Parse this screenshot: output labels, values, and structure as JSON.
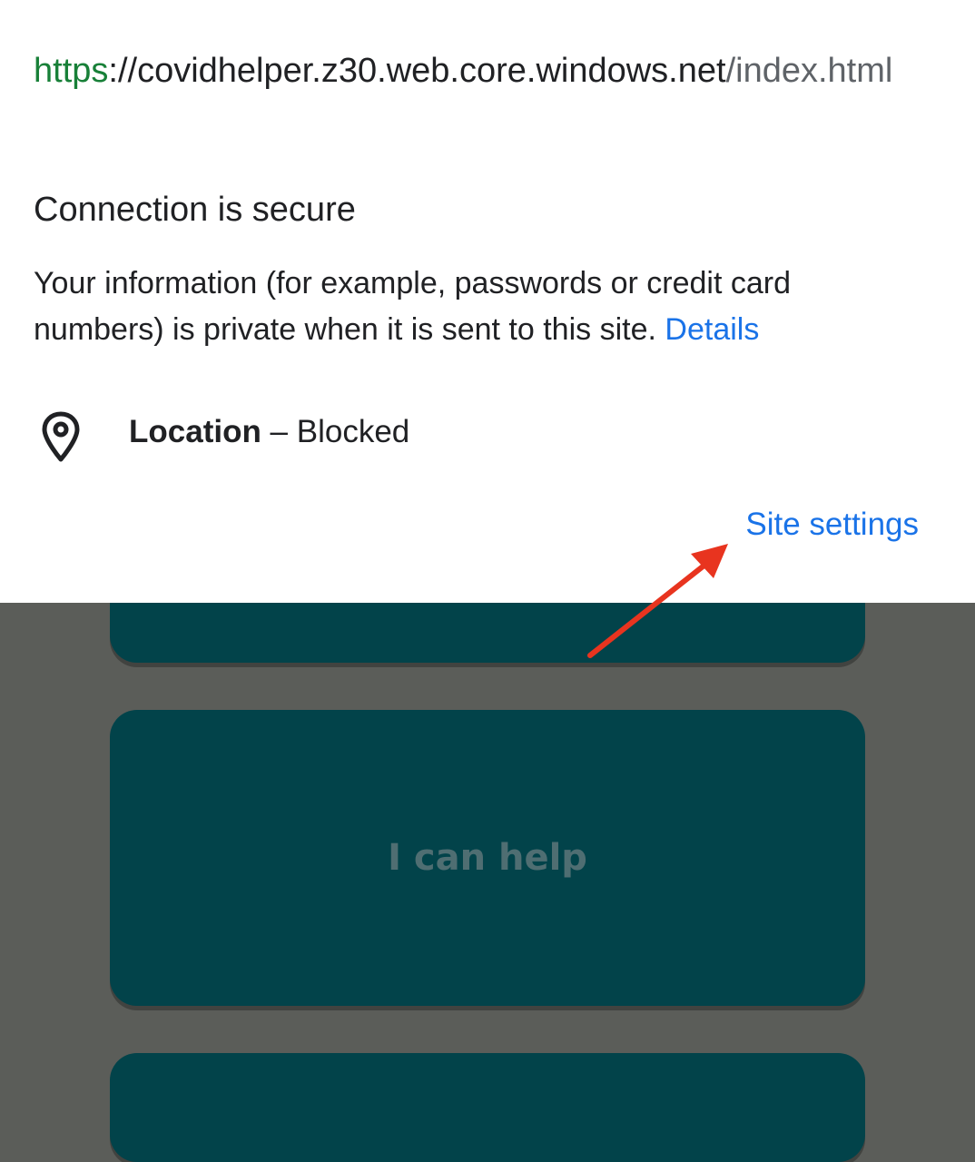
{
  "site_info": {
    "url_scheme": "https",
    "url_host": "://covidhelper.z30.web.core.windows.net",
    "url_path": "/index.html",
    "title": "Connection is secure",
    "description": "Your information (for example, passwords or credit card numbers) is private when it is sent to this site.",
    "details_link": "Details",
    "permission": {
      "icon": "location-pin-icon",
      "name": "Location",
      "separator": " – ",
      "state": "Blocked"
    },
    "site_settings_link": "Site settings"
  },
  "background_page": {
    "help_button_label": "I can help"
  },
  "colors": {
    "url_scheme": "#188038",
    "link": "#1a73e8",
    "card": "#02434a",
    "scrim": "#5b5d59",
    "annotation_arrow": "#e8341f"
  }
}
